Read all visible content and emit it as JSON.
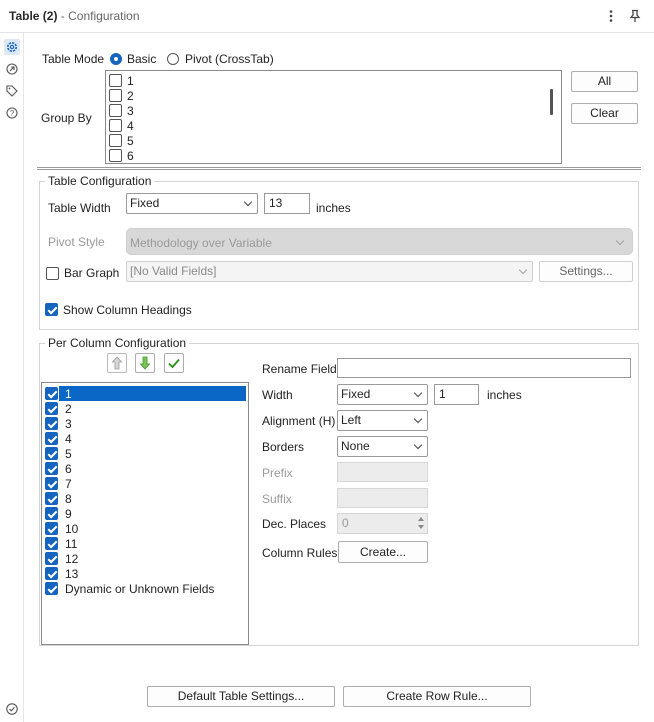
{
  "header": {
    "title_bold": "Table (2)",
    "title_rest": "- Configuration"
  },
  "sidebar_icons": [
    "gear-icon",
    "eye-icon",
    "tag-icon",
    "help-icon",
    "check-circle-icon"
  ],
  "table_mode": {
    "label": "Table Mode",
    "basic": "Basic",
    "pivot": "Pivot (CrossTab)",
    "selected": "Basic"
  },
  "group_by": {
    "label": "Group By",
    "items": [
      "1",
      "2",
      "3",
      "4",
      "5",
      "6"
    ],
    "all_btn": "All",
    "clear_btn": "Clear"
  },
  "table_config": {
    "legend": "Table Configuration",
    "width_label": "Table Width",
    "width_mode": "Fixed",
    "width_value": "13",
    "width_unit": "inches",
    "pivot_label": "Pivot Style",
    "pivot_value": "Methodology over Variable",
    "bar_graph_label": "Bar Graph",
    "bar_graph_value": "[No Valid Fields]",
    "settings_btn": "Settings...",
    "show_headings_label": "Show Column Headings"
  },
  "per_column": {
    "legend": "Per Column Configuration",
    "columns": [
      "1",
      "2",
      "3",
      "4",
      "5",
      "6",
      "7",
      "8",
      "9",
      "10",
      "11",
      "12",
      "13",
      "Dynamic or Unknown Fields"
    ],
    "selected_index": 0,
    "rename_label": "Rename Field",
    "rename_value": "",
    "width_label": "Width",
    "width_mode": "Fixed",
    "width_value": "1",
    "width_unit": "inches",
    "align_label": "Alignment (H)",
    "align_value": "Left",
    "borders_label": "Borders",
    "borders_value": "None",
    "prefix_label": "Prefix",
    "suffix_label": "Suffix",
    "dec_label": "Dec. Places",
    "dec_value": "0",
    "rules_label": "Column Rules",
    "create_btn": "Create..."
  },
  "footer": {
    "default_btn": "Default Table Settings...",
    "row_rule_btn": "Create Row Rule..."
  },
  "colors": {
    "accent": "#1565c0",
    "selection": "#0b67c5",
    "green_arrow": "#3a9d23"
  }
}
